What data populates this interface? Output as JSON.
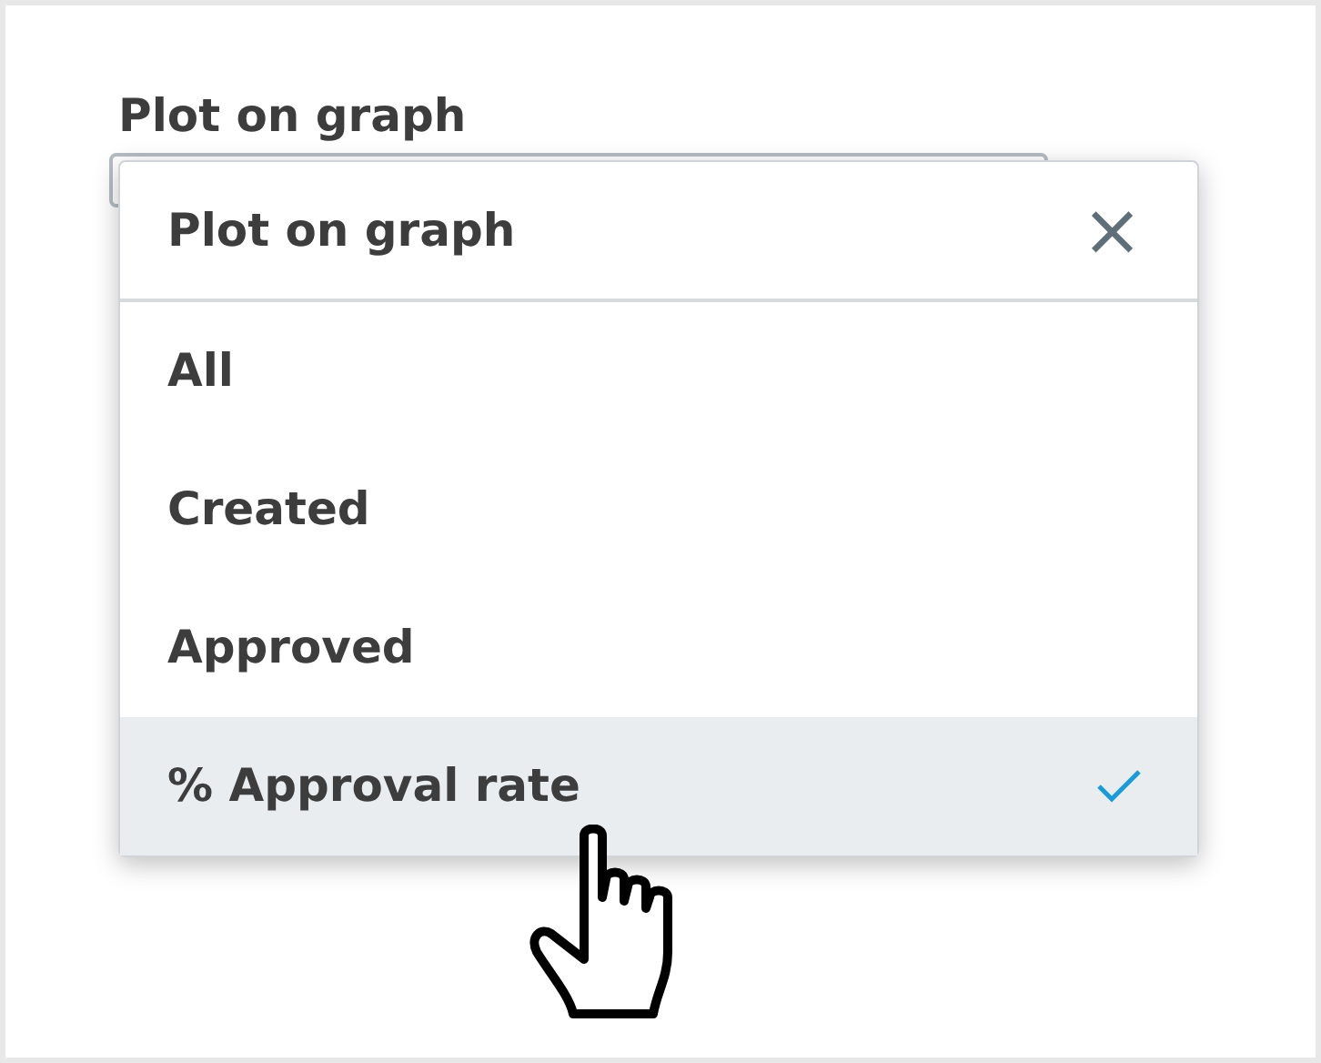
{
  "field": {
    "label": "Plot on graph"
  },
  "dropdown": {
    "title": "Plot on graph",
    "close": "×",
    "options": [
      {
        "label": "All",
        "selected": false
      },
      {
        "label": "Created",
        "selected": false
      },
      {
        "label": "Approved",
        "selected": false
      },
      {
        "label": "% Approval rate",
        "selected": true
      }
    ]
  }
}
